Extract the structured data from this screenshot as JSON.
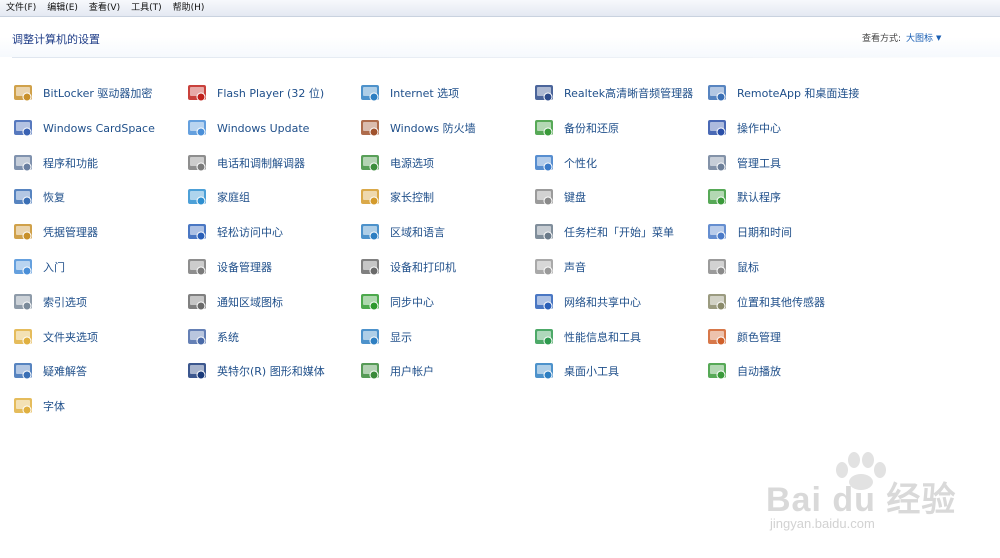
{
  "menu": [
    "文件(F)",
    "编辑(E)",
    "查看(V)",
    "工具(T)",
    "帮助(H)"
  ],
  "header": {
    "title": "调整计算机的设置",
    "view_label": "查看方式:",
    "view_value": "大图标"
  },
  "items": [
    {
      "label": "BitLocker 驱动器加密",
      "icon": "key-icon",
      "color": "#c8902a"
    },
    {
      "label": "Flash Player (32 位)",
      "icon": "flash-icon",
      "color": "#c0201a"
    },
    {
      "label": "Internet 选项",
      "icon": "globe-icon",
      "color": "#2e7fc2"
    },
    {
      "label": "Realtek高清晰音频管理器",
      "icon": "speaker-icon",
      "color": "#2c4a8a"
    },
    {
      "label": "RemoteApp 和桌面连接",
      "icon": "remote-desktop-icon",
      "color": "#3a6fb5"
    },
    {
      "label": "Windows CardSpace",
      "icon": "cardspace-icon",
      "color": "#3a62b3"
    },
    {
      "label": "Windows Update",
      "icon": "windows-update-icon",
      "color": "#4a8fd8"
    },
    {
      "label": "Windows 防火墙",
      "icon": "firewall-icon",
      "color": "#a0522d"
    },
    {
      "label": "备份和还原",
      "icon": "backup-icon",
      "color": "#3a9a3a"
    },
    {
      "label": "操作中心",
      "icon": "flag-icon",
      "color": "#2a4fa8"
    },
    {
      "label": "程序和功能",
      "icon": "programs-icon",
      "color": "#6a7fa0"
    },
    {
      "label": "电话和调制解调器",
      "icon": "phone-icon",
      "color": "#7a7a7a"
    },
    {
      "label": "电源选项",
      "icon": "power-icon",
      "color": "#3b8e3b"
    },
    {
      "label": "个性化",
      "icon": "personalize-icon",
      "color": "#3a7ac8"
    },
    {
      "label": "管理工具",
      "icon": "admin-tools-icon",
      "color": "#6d7f99"
    },
    {
      "label": "恢复",
      "icon": "recovery-icon",
      "color": "#3a6fb5"
    },
    {
      "label": "家庭组",
      "icon": "homegroup-icon",
      "color": "#2e8fd0"
    },
    {
      "label": "家长控制",
      "icon": "parental-icon",
      "color": "#d49a2a"
    },
    {
      "label": "键盘",
      "icon": "keyboard-icon",
      "color": "#8a8a8a"
    },
    {
      "label": "默认程序",
      "icon": "default-programs-icon",
      "color": "#3a9a3a"
    },
    {
      "label": "凭据管理器",
      "icon": "vault-icon",
      "color": "#c8902a"
    },
    {
      "label": "轻松访问中心",
      "icon": "ease-access-icon",
      "color": "#2a5fb8"
    },
    {
      "label": "区域和语言",
      "icon": "region-icon",
      "color": "#2e7fc2"
    },
    {
      "label": "任务栏和「开始」菜单",
      "icon": "taskbar-icon",
      "color": "#6a7a8a"
    },
    {
      "label": "日期和时间",
      "icon": "calendar-icon",
      "color": "#4a7ac8"
    },
    {
      "label": "入门",
      "icon": "getting-started-icon",
      "color": "#4a8fd8"
    },
    {
      "label": "设备管理器",
      "icon": "device-manager-icon",
      "color": "#7a7a7a"
    },
    {
      "label": "设备和打印机",
      "icon": "printer-icon",
      "color": "#6a6a6a"
    },
    {
      "label": "声音",
      "icon": "sound-icon",
      "color": "#9a9a9a"
    },
    {
      "label": "鼠标",
      "icon": "mouse-icon",
      "color": "#8a8a8a"
    },
    {
      "label": "索引选项",
      "icon": "index-icon",
      "color": "#7a8a9a"
    },
    {
      "label": "通知区域图标",
      "icon": "notification-icon",
      "color": "#6a6a6a"
    },
    {
      "label": "同步中心",
      "icon": "sync-icon",
      "color": "#2e9a2e"
    },
    {
      "label": "网络和共享中心",
      "icon": "network-icon",
      "color": "#2a5fb8"
    },
    {
      "label": "位置和其他传感器",
      "icon": "sensor-icon",
      "color": "#8a8a6a"
    },
    {
      "label": "文件夹选项",
      "icon": "folder-options-icon",
      "color": "#e0b040"
    },
    {
      "label": "系统",
      "icon": "system-icon",
      "color": "#4a6aa8"
    },
    {
      "label": "显示",
      "icon": "display-icon",
      "color": "#2e7fc2"
    },
    {
      "label": "性能信息和工具",
      "icon": "performance-icon",
      "color": "#2e9a4e"
    },
    {
      "label": "颜色管理",
      "icon": "color-icon",
      "color": "#d0602a"
    },
    {
      "label": "疑难解答",
      "icon": "troubleshoot-icon",
      "color": "#3a6fb5"
    },
    {
      "label": "英特尔(R) 图形和媒体",
      "icon": "intel-graphics-icon",
      "color": "#1a3a7a"
    },
    {
      "label": "用户帐户",
      "icon": "user-accounts-icon",
      "color": "#3a8a3a"
    },
    {
      "label": "桌面小工具",
      "icon": "gadgets-icon",
      "color": "#2e7fc2"
    },
    {
      "label": "自动播放",
      "icon": "autoplay-icon",
      "color": "#3a9a3a"
    },
    {
      "label": "字体",
      "icon": "fonts-icon",
      "color": "#e0b040"
    }
  ],
  "watermark": {
    "brand": "Bai du 经验",
    "url": "jingyan.baidu.com"
  }
}
